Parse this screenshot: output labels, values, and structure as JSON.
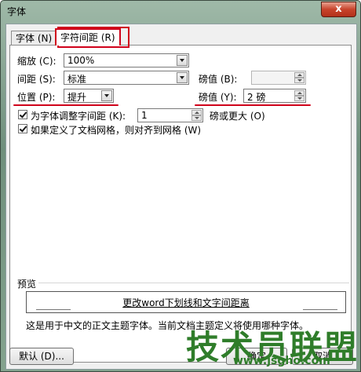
{
  "window": {
    "title": "字体",
    "close_glyph": "x"
  },
  "tabs": [
    {
      "label": "字体 (N)"
    },
    {
      "label": "字符间距 (R)"
    }
  ],
  "scale": {
    "label": "缩放 (C):",
    "value": "100%"
  },
  "spacing": {
    "label": "间距 (S):",
    "value": "标准",
    "amount_label": "磅值 (B):",
    "amount_value": ""
  },
  "position": {
    "label": "位置 (P):",
    "value": "提升",
    "amount_label": "磅值 (Y):",
    "amount_value": "2 磅"
  },
  "kerning": {
    "label": "为字体调整字间距 (K):",
    "value": "1",
    "suffix": "磅或更大 (O)"
  },
  "grid": {
    "label": "如果定义了文档网格，则对齐到网格 (W)"
  },
  "preview": {
    "group_label": "预览",
    "sample": "更改word下划线和文字间距离",
    "note": "这是用于中文的正文主题字体。当前文档主题定义将使用哪种字体。"
  },
  "buttons": {
    "default": "默认 (D)...",
    "ok": "确定",
    "cancel": "取消"
  },
  "watermark": {
    "text": "技术员联盟",
    "url": "www.jsgho.com"
  },
  "colors": {
    "highlight": "#d0021b",
    "watermark": "#2f7d2a"
  }
}
